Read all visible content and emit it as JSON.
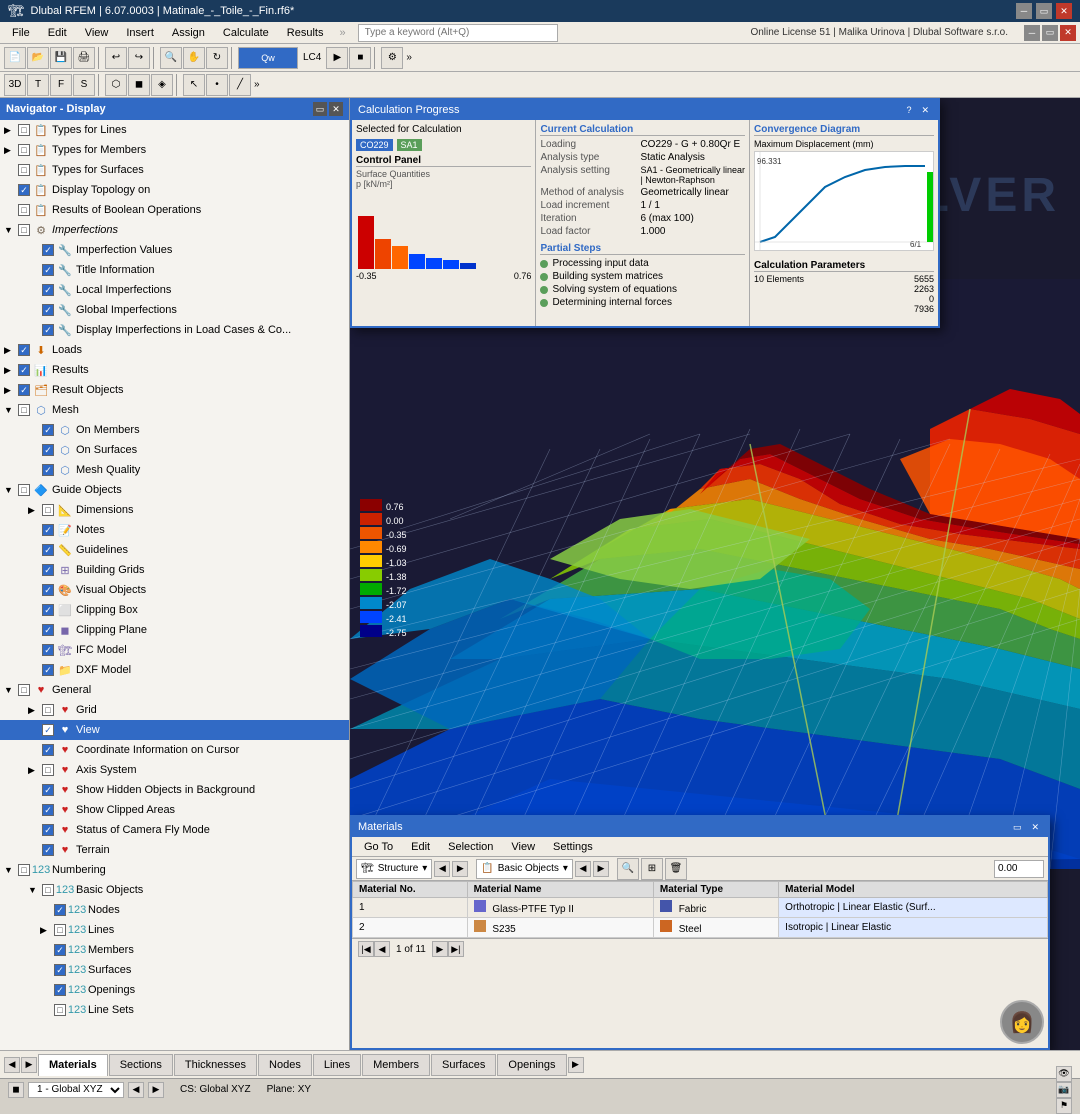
{
  "app": {
    "title": "Dlubal RFEM | 6.07.0003 | Matinale_-_Toile_-_Fin.rf6*",
    "online_info": "Online License 51 | Malika Urinova | Dlubal Software s.r.o."
  },
  "menu": {
    "items": [
      "File",
      "Edit",
      "View",
      "Insert",
      "Assign",
      "Calculate",
      "Results"
    ],
    "search_placeholder": "Type a keyword (Alt+Q)"
  },
  "navigator": {
    "title": "Navigator - Display",
    "items": [
      {
        "label": "Types for Lines",
        "level": 1,
        "expand": true,
        "checked": "partial"
      },
      {
        "label": "Types for Members",
        "level": 1,
        "expand": true,
        "checked": "partial"
      },
      {
        "label": "Types for Surfaces",
        "level": 1,
        "expand": false,
        "checked": "partial"
      },
      {
        "label": "Display Topology on",
        "level": 1,
        "expand": false,
        "checked": "checked"
      },
      {
        "label": "Results of Boolean Operations",
        "level": 1,
        "expand": false,
        "checked": "partial"
      },
      {
        "label": "Imperfections",
        "level": 1,
        "expand": true,
        "checked": "partial",
        "section": true
      },
      {
        "label": "Imperfection Values",
        "level": 2,
        "expand": false,
        "checked": "checked"
      },
      {
        "label": "Title Information",
        "level": 2,
        "expand": false,
        "checked": "checked"
      },
      {
        "label": "Local Imperfections",
        "level": 2,
        "expand": false,
        "checked": "checked"
      },
      {
        "label": "Global Imperfections",
        "level": 2,
        "expand": false,
        "checked": "checked"
      },
      {
        "label": "Display Imperfections in Load Cases & Co...",
        "level": 2,
        "expand": false,
        "checked": "checked"
      },
      {
        "label": "Loads",
        "level": 1,
        "expand": false,
        "checked": "partial"
      },
      {
        "label": "Results",
        "level": 1,
        "expand": false,
        "checked": "partial"
      },
      {
        "label": "Result Objects",
        "level": 1,
        "expand": false,
        "checked": "partial"
      },
      {
        "label": "Mesh",
        "level": 1,
        "expand": true,
        "checked": "partial",
        "section": true
      },
      {
        "label": "On Members",
        "level": 2,
        "expand": false,
        "checked": "checked"
      },
      {
        "label": "On Surfaces",
        "level": 2,
        "expand": false,
        "checked": "checked"
      },
      {
        "label": "Mesh Quality",
        "level": 2,
        "expand": false,
        "checked": "checked"
      },
      {
        "label": "Guide Objects",
        "level": 1,
        "expand": true,
        "checked": "partial",
        "section": true
      },
      {
        "label": "Dimensions",
        "level": 2,
        "expand": true,
        "checked": "partial"
      },
      {
        "label": "Notes",
        "level": 2,
        "expand": false,
        "checked": "checked"
      },
      {
        "label": "Guidelines",
        "level": 2,
        "expand": false,
        "checked": "checked"
      },
      {
        "label": "Building Grids",
        "level": 2,
        "expand": false,
        "checked": "checked"
      },
      {
        "label": "Visual Objects",
        "level": 2,
        "expand": false,
        "checked": "checked"
      },
      {
        "label": "Clipping Box",
        "level": 2,
        "expand": false,
        "checked": "checked"
      },
      {
        "label": "Clipping Plane",
        "level": 2,
        "expand": false,
        "checked": "checked"
      },
      {
        "label": "IFC Model",
        "level": 2,
        "expand": false,
        "checked": "checked"
      },
      {
        "label": "DXF Model",
        "level": 2,
        "expand": false,
        "checked": "checked"
      },
      {
        "label": "General",
        "level": 1,
        "expand": true,
        "checked": "partial",
        "section": true
      },
      {
        "label": "Grid",
        "level": 2,
        "expand": false,
        "checked": "partial"
      },
      {
        "label": "View",
        "level": 2,
        "expand": false,
        "checked": "checked",
        "selected": true
      },
      {
        "label": "Coordinate Information on Cursor",
        "level": 2,
        "expand": false,
        "checked": "checked"
      },
      {
        "label": "Axis System",
        "level": 2,
        "expand": false,
        "checked": "partial"
      },
      {
        "label": "Show Hidden Objects in Background",
        "level": 2,
        "expand": false,
        "checked": "checked"
      },
      {
        "label": "Show Clipped Areas",
        "level": 2,
        "expand": false,
        "checked": "checked"
      },
      {
        "label": "Status of Camera Fly Mode",
        "level": 2,
        "expand": false,
        "checked": "checked"
      },
      {
        "label": "Terrain",
        "level": 2,
        "expand": false,
        "checked": "checked"
      },
      {
        "label": "Numbering",
        "level": 1,
        "expand": true,
        "checked": "partial",
        "section": true
      },
      {
        "label": "Basic Objects",
        "level": 2,
        "expand": true,
        "checked": "partial"
      },
      {
        "label": "Nodes",
        "level": 3,
        "expand": false,
        "checked": "checked"
      },
      {
        "label": "Lines",
        "level": 3,
        "expand": true,
        "checked": "partial"
      },
      {
        "label": "Members",
        "level": 3,
        "expand": false,
        "checked": "checked"
      },
      {
        "label": "Surfaces",
        "level": 3,
        "expand": false,
        "checked": "checked"
      },
      {
        "label": "Openings",
        "level": 3,
        "expand": false,
        "checked": "checked"
      },
      {
        "label": "Line Sets",
        "level": 3,
        "expand": false,
        "checked": "partial"
      }
    ]
  },
  "calc_dialog": {
    "title": "Calculation Progress",
    "selected_label": "Selected for Calculation",
    "lc_badge": "CO229",
    "sa_badge": "SA1",
    "control_panel": "Control Panel",
    "surface_quantities_label": "Surface Quantities\np [kN/m²]",
    "qty_values": [
      "0.76",
      "0.00",
      "0.35",
      "-0.69",
      "-1.03",
      "-1.38",
      "-1.72",
      "-2.07",
      "-2.41",
      "-2.75"
    ],
    "current_calc_title": "Current Calculation",
    "fields": [
      {
        "label": "Loading",
        "value": "CO229 - G + 0.80Qr E"
      },
      {
        "label": "Analysis type",
        "value": "Static Analysis"
      },
      {
        "label": "Analysis setting",
        "value": "SA1 - Geometrically linear | Newton-Raphson"
      },
      {
        "label": "Method of analysis",
        "value": "Geometrically linear"
      },
      {
        "label": "Load increment",
        "value": "1 / 1"
      },
      {
        "label": "Iteration",
        "value": "6 (max 100)"
      },
      {
        "label": "Load factor",
        "value": "1.000"
      }
    ],
    "partial_steps_title": "Partial Steps",
    "steps": [
      {
        "label": "Processing input data",
        "done": true
      },
      {
        "label": "Building system matrices",
        "done": true
      },
      {
        "label": "Solving system of equations",
        "done": true
      },
      {
        "label": "Determining internal forces",
        "done": true
      }
    ],
    "convergence_title": "Convergence Diagram",
    "convergence_subtitle": "Maximum Displacement (mm)",
    "convergence_value": "96.331",
    "convergence_x": "6/1",
    "calc_params_title": "Calculation Parameters",
    "param_fields": [
      {
        "label": "10 Elements",
        "value": "5655"
      },
      {
        "label": "",
        "value": "2263"
      },
      {
        "label": "",
        "value": "0"
      },
      {
        "label": "",
        "value": "7936"
      }
    ]
  },
  "color_legend": {
    "title": "Surface Quantities",
    "values": [
      {
        "color": "#8B0000",
        "val": "0.76"
      },
      {
        "color": "#cc0000",
        "val": "0.00"
      },
      {
        "color": "#ff4400",
        "val": "-0.35"
      },
      {
        "color": "#ff8800",
        "val": "-0.69"
      },
      {
        "color": "#ffcc00",
        "val": "-1.03"
      },
      {
        "color": "#88cc00",
        "val": "-1.38"
      },
      {
        "color": "#00aa00",
        "val": "-1.72"
      },
      {
        "color": "#0088cc",
        "val": "-2.07"
      },
      {
        "color": "#0044ff",
        "val": "-2.41"
      },
      {
        "color": "#000088",
        "val": "-2.75"
      }
    ]
  },
  "materials": {
    "title": "Materials",
    "menu_items": [
      "Go To",
      "Edit",
      "Selection",
      "View",
      "Settings"
    ],
    "dropdown1": "Structure",
    "dropdown2": "Basic Objects",
    "columns": [
      "Material No.",
      "Material Name",
      "Material Type",
      "Material Model"
    ],
    "rows": [
      {
        "no": "1",
        "name": "Glass-PTFE Typ II",
        "color": "#6666cc",
        "type": "Fabric",
        "type_color": "#4455aa",
        "model": "Orthotropic | Linear Elastic (Surf...",
        "model_color": "#aaccff"
      },
      {
        "no": "2",
        "name": "S235",
        "color": "#cc8844",
        "type": "Steel",
        "type_color": "#cc6622",
        "model": "Isotropic | Linear Elastic",
        "model_color": "#aaccff"
      }
    ],
    "pagination": "1 of 11"
  },
  "bottom_tabs": {
    "tabs": [
      "Materials",
      "Sections",
      "Thicknesses",
      "Nodes",
      "Lines",
      "Members",
      "Surfaces",
      "Openings"
    ],
    "active": "Materials"
  },
  "status_bar": {
    "lc_label": "1 - Global XYZ",
    "cs_label": "CS: Global XYZ",
    "plane_label": "Plane: XY"
  }
}
